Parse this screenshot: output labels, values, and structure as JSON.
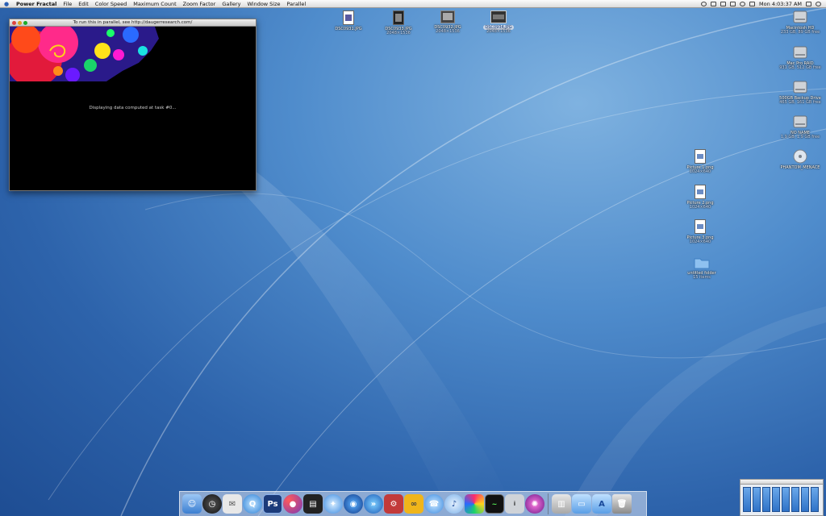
{
  "menubar": {
    "app_name": "Power Fractal",
    "menus": [
      "File",
      "Edit",
      "Color Speed",
      "Maximum Count",
      "Zoom Factor",
      "Gallery",
      "Window Size",
      "Parallel"
    ],
    "clock": "Mon 4:03:37 AM"
  },
  "fractal_window": {
    "title": "To run this in parallel, see http://daugerresearch.com/",
    "status": "Displaying data computed at task #0..."
  },
  "top_icons": [
    {
      "label": "DSC0931.JPG",
      "sub": ""
    },
    {
      "label": "DSC0933.JPG",
      "sub": "2048×1536"
    },
    {
      "label": "DSC0932.JPG",
      "sub": "2048×1536"
    },
    {
      "label": "DSC0934.JPG",
      "sub": "2048×1536"
    }
  ],
  "volumes": [
    {
      "label": "Macintosh HD",
      "sub": "233 GB, 89 GB free"
    },
    {
      "label": "Mac Pro RAID",
      "sub": "931 GB, 512 GB free"
    },
    {
      "label": "500GB Backup Drive",
      "sub": "465 GB, 161 GB free"
    },
    {
      "label": "NO NAME",
      "sub": "1.9 GB, 1.9 GB free"
    },
    {
      "label": "PHANTOM_MENACE",
      "sub": ""
    }
  ],
  "files": [
    {
      "label": "Picture 1.png",
      "sub": "1024×640"
    },
    {
      "label": "Picture 2.png",
      "sub": "1024×640"
    },
    {
      "label": "Picture 3.png",
      "sub": "1024×640"
    },
    {
      "label": "untitled folder",
      "sub": "15 items"
    }
  ],
  "dock": {
    "apps": [
      "Finder",
      "Dashboard",
      "Mail",
      "iChat",
      "Photoshop",
      "Color Sync",
      "Final Cut",
      "Safari",
      "World",
      "Quicktime",
      "Chess",
      "Dock App",
      "iChat AV",
      "iTunes",
      "Fractal",
      "Activity Monitor",
      "Info",
      "Pinwheel"
    ],
    "docs": [
      "Docs",
      "Folder",
      "Applications",
      "Trash"
    ]
  },
  "colors": {
    "desktop_blue": "#2d63ab",
    "accent": "#2b5fb4"
  }
}
